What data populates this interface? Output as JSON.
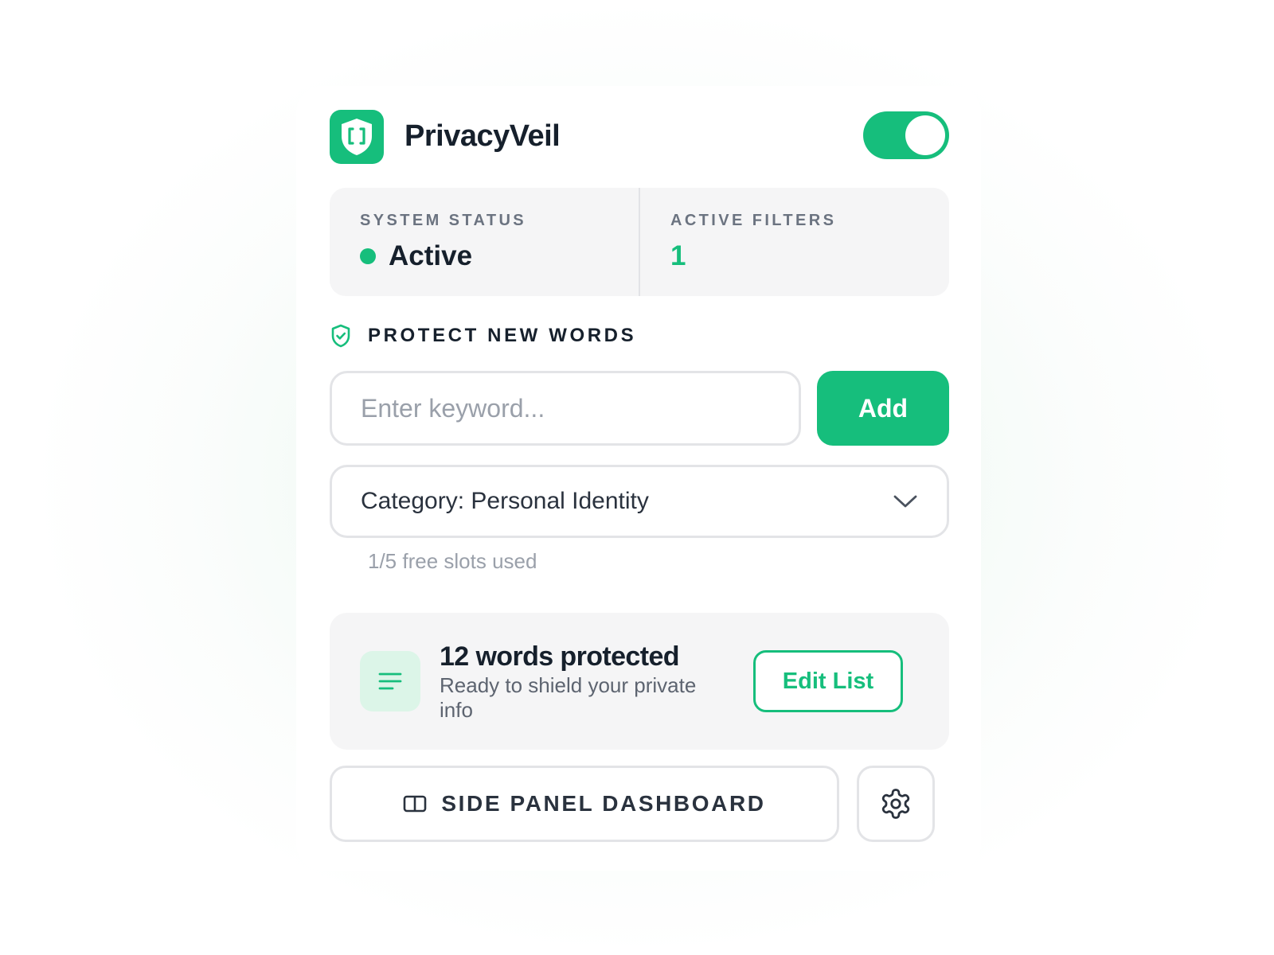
{
  "app": {
    "name": "PrivacyVeil",
    "logo_icon": "shield-brackets-icon",
    "protection_enabled": true,
    "accent_color": "#16be7c"
  },
  "status": {
    "system_status_label": "SYSTEM STATUS",
    "system_status_value": "Active",
    "active_filters_label": "ACTIVE FILTERS",
    "active_filters_value": "1"
  },
  "protect": {
    "heading": "PROTECT NEW WORDS",
    "heading_icon": "shield-check-icon",
    "keyword_placeholder": "Enter keyword...",
    "keyword_value": "",
    "add_label": "Add",
    "category_selected": "Category: Personal Identity",
    "slots_text": "1/5 free slots used"
  },
  "protected_summary": {
    "icon": "list-icon",
    "title": "12 words protected",
    "subtitle": "Ready to shield your private info",
    "edit_label": "Edit List"
  },
  "footer": {
    "dashboard_label": "SIDE PANEL DASHBOARD",
    "dashboard_icon": "side-panel-icon",
    "settings_icon": "gear-icon"
  }
}
